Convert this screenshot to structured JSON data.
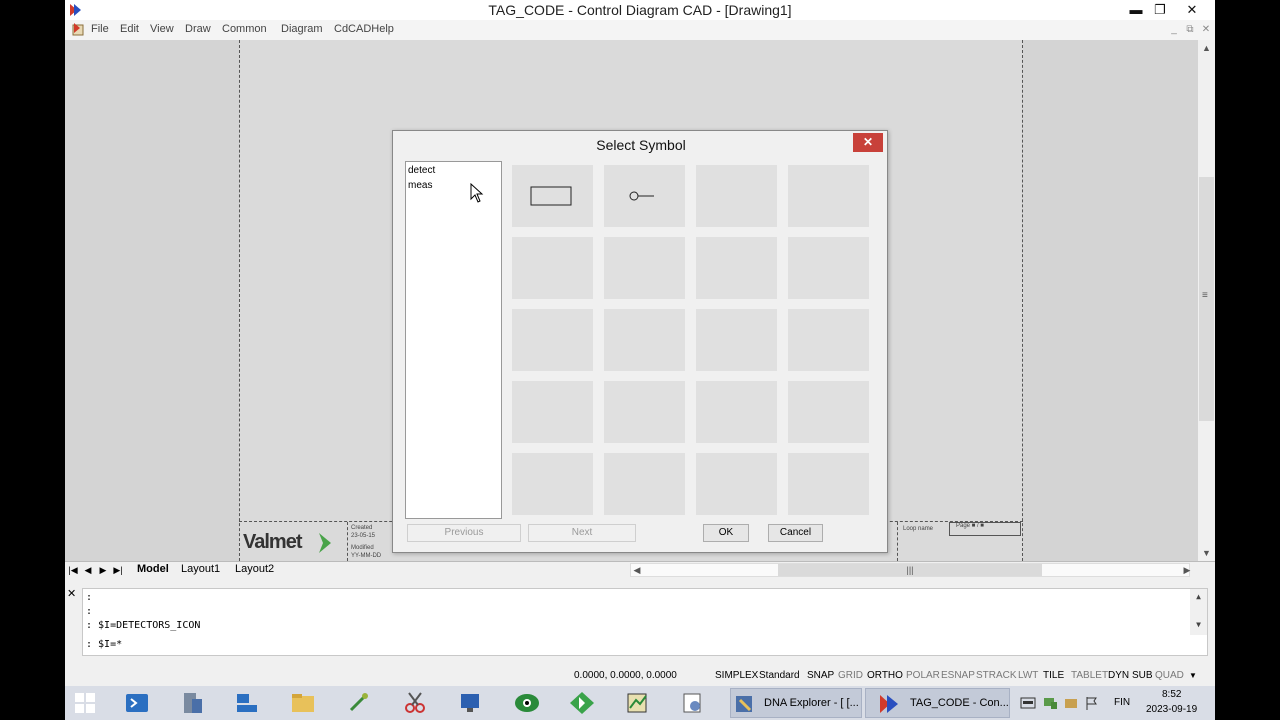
{
  "window": {
    "title": "TAG_CODE - Control Diagram CAD - [Drawing1]",
    "minimize": "▬",
    "restore": "❐",
    "close": "✕"
  },
  "menu": {
    "items": [
      "File",
      "Edit",
      "View",
      "Draw",
      "Common",
      "Diagram",
      "CdCADHelp"
    ],
    "mdi_minimize": "_",
    "mdi_restore": "⧉",
    "mdi_close": "✕"
  },
  "titleblock": {
    "logo_text": "Valmet",
    "created_label": "Created",
    "created_value": "23-05-15",
    "modified_label": "Modified",
    "modified_value": "YY-MM-DD",
    "loop_label": "Loop name",
    "page_label": "Page ■ / ■"
  },
  "tabs": {
    "items": [
      "Model",
      "Layout1",
      "Layout2"
    ],
    "active": "Model"
  },
  "command": {
    "lines": [
      ":",
      ":",
      ": $I=DETECTORS_ICON",
      ": $I=*"
    ]
  },
  "status": {
    "coords": "0.0000, 0.0000, 0.0000",
    "buttons": [
      {
        "label": "SIMPLEX",
        "on": true
      },
      {
        "label": "Standard",
        "on": true
      },
      {
        "label": "SNAP",
        "on": true
      },
      {
        "label": "GRID",
        "on": false
      },
      {
        "label": "ORTHO",
        "on": true
      },
      {
        "label": "POLAR",
        "on": false
      },
      {
        "label": "ESNAP",
        "on": false
      },
      {
        "label": "STRACK",
        "on": false
      },
      {
        "label": "LWT",
        "on": false
      },
      {
        "label": "TILE",
        "on": true
      },
      {
        "label": "TABLET",
        "on": false
      },
      {
        "label": "DYN",
        "on": true
      },
      {
        "label": "SUB",
        "on": true
      },
      {
        "label": "QUAD",
        "on": false
      }
    ]
  },
  "dialog": {
    "title": "Select Symbol",
    "close": "✕",
    "list": [
      "detect",
      "meas"
    ],
    "buttons": {
      "previous": "Previous",
      "next": "Next",
      "ok": "OK",
      "cancel": "Cancel"
    },
    "grid": {
      "rows": 5,
      "cols": 4,
      "symbols": [
        "rectangle",
        "circle-line"
      ]
    }
  },
  "taskbar": {
    "tasks": [
      {
        "label": "DNA Explorer - [ [..."
      },
      {
        "label": "TAG_CODE - Con..."
      }
    ],
    "tray": {
      "lang": "FIN",
      "time": "8:52",
      "date": "2023-09-19"
    }
  },
  "colors": {
    "dialog_close": "#c8413a",
    "cell": "#e0e0e0",
    "drawing_bg": "#d4d4d4"
  }
}
